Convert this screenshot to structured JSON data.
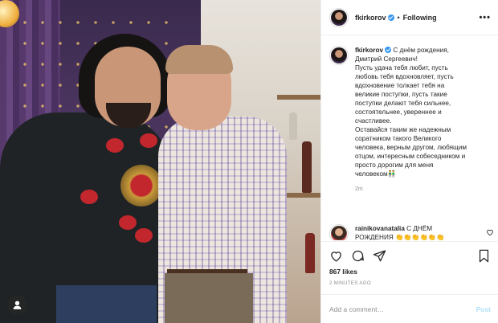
{
  "header": {
    "username": "fkirkorov",
    "separator": "•",
    "follow_label": "Following",
    "more_label": "•••"
  },
  "caption": {
    "username": "fkirkorov",
    "lines": [
      "С днём рождения,",
      "Дмитрий Сергеевич!",
      "Пусть удача тебя любит, пусть",
      "любовь тебя вдохновляет, пусть",
      "вдохновение толкает тебя на",
      "великие поступки, пусть такие",
      "поступки делают тебя сильнее,",
      "состоятельнее, увереннее и",
      "счастливее.",
      "Оставайся таким же надежным",
      "соратником такого Великого",
      "человека, верным другом, любящим",
      "отцом, интересным собеседником и",
      "просто дорогим для меня",
      "человеком👬"
    ],
    "time": "2m"
  },
  "comment": {
    "username": "rainikovanatalia",
    "text": "С ДНЁМ",
    "text2": "РОЖДЕНИЯ 👏👏👏👏👏👏"
  },
  "actions": {
    "like_icon": "heart-icon",
    "comment_icon": "comment-icon",
    "share_icon": "share-icon",
    "save_icon": "bookmark-icon"
  },
  "likes": "867 likes",
  "timestamp": "2 MINUTES AGO",
  "add_comment": {
    "placeholder": "Add a comment…",
    "post_label": "Post"
  },
  "colors": {
    "verified": "#3897f0",
    "post_disabled": "#b2dffc",
    "meta_text": "#8e8e8e"
  }
}
